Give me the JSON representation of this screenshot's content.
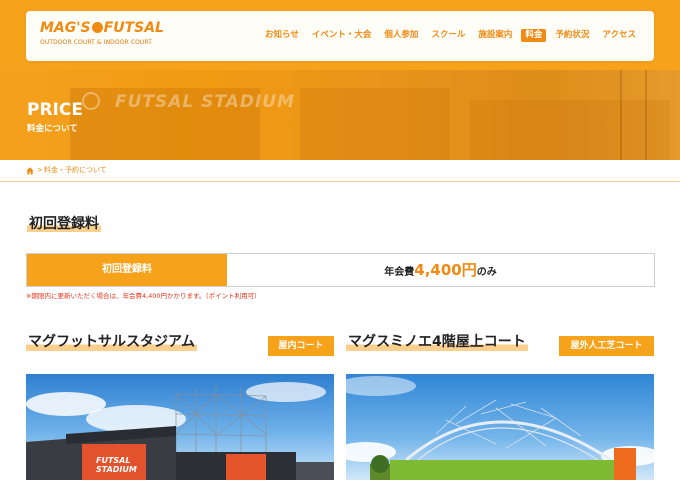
{
  "header": {
    "logo_main_left": "MAG'S",
    "logo_main_right": "FUTSAL",
    "logo_sub": "OUTDOOR COURT & INDOOR COURT",
    "nav": [
      "お知らせ",
      "イベント・大会",
      "個人参加",
      "スクール",
      "施設案内",
      "料金",
      "予約状況",
      "アクセス"
    ],
    "active_nav": "料金"
  },
  "hero": {
    "title": "PRICE",
    "subtitle": "料金について",
    "photo_sign": "FUTSAL STADIUM"
  },
  "breadcrumb": {
    "separator": ">",
    "current": "料金・予約について"
  },
  "registration": {
    "heading": "初回登録料",
    "label": "初回登録料",
    "value_prefix": "年会費",
    "value_amount": "4,400円",
    "value_suffix": "のみ",
    "note": "※期限内に更新いただく場合は、年会費4,400円かかります。（ポイント利用可）"
  },
  "venues": [
    {
      "name": "マグフットサルスタジアム",
      "tag": "屋内コート",
      "sign": "FUTSAL STADIUM"
    },
    {
      "name": "マグスミノエ4階屋上コート",
      "tag": "屋外人工芝コート"
    }
  ],
  "colors": {
    "accent": "#f08a12",
    "hero": "#f7a21b",
    "highlight": "#fbd08f",
    "note": "#e8331a"
  }
}
